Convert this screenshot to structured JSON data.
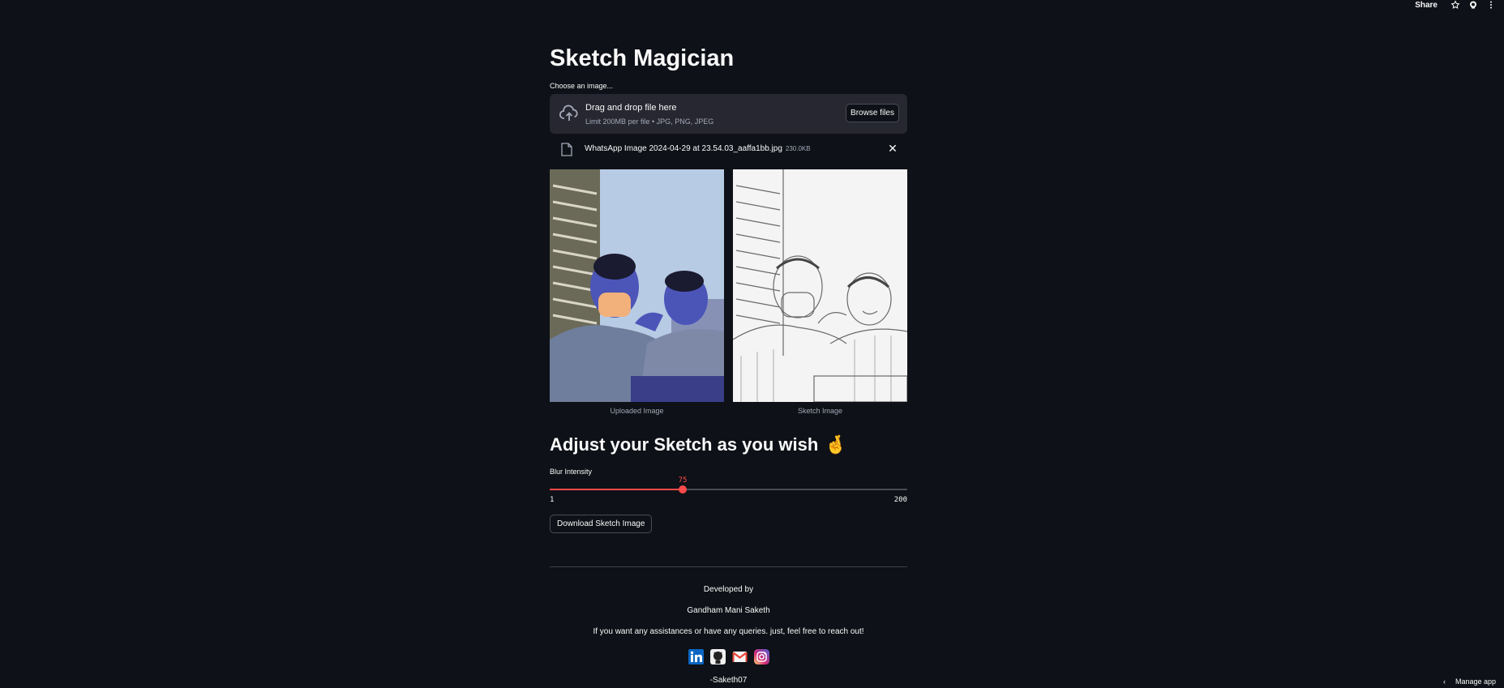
{
  "topbar": {
    "share_label": "Share",
    "icons": [
      "star-icon",
      "github-icon",
      "more-vertical-icon"
    ]
  },
  "page": {
    "title": "Sketch Magician"
  },
  "uploader": {
    "label": "Choose an image...",
    "dropzone_title": "Drag and drop file here",
    "dropzone_subtitle": "Limit 200MB per file • JPG, PNG, JPEG",
    "browse_label": "Browse files",
    "file_name": "WhatsApp Image 2024-04-29 at 23.54.03_aaffa1bb.jpg",
    "file_size": "230.0KB"
  },
  "images": {
    "uploaded_caption": "Uploaded Image",
    "sketch_caption": "Sketch Image"
  },
  "adjust": {
    "heading": "Adjust your Sketch as you wish",
    "emoji": "🤞",
    "slider_label": "Blur Intensity",
    "slider_value": "75",
    "slider_min": "1",
    "slider_max": "200",
    "download_label": "Download Sketch Image"
  },
  "footer": {
    "developed_by": "Developed by",
    "author": "Gandham Mani Saketh",
    "message": "If you want any assistances or have any queries. just, feel free to reach out!",
    "socials": [
      "linkedin-icon",
      "github-icon",
      "gmail-icon",
      "instagram-icon"
    ],
    "signature": "-Saketh07"
  },
  "manage_app": {
    "label": "Manage app"
  },
  "colors": {
    "background": "#0e1117",
    "surface": "#262730",
    "accent": "#ff4b4b",
    "muted": "#a3a8b8"
  }
}
